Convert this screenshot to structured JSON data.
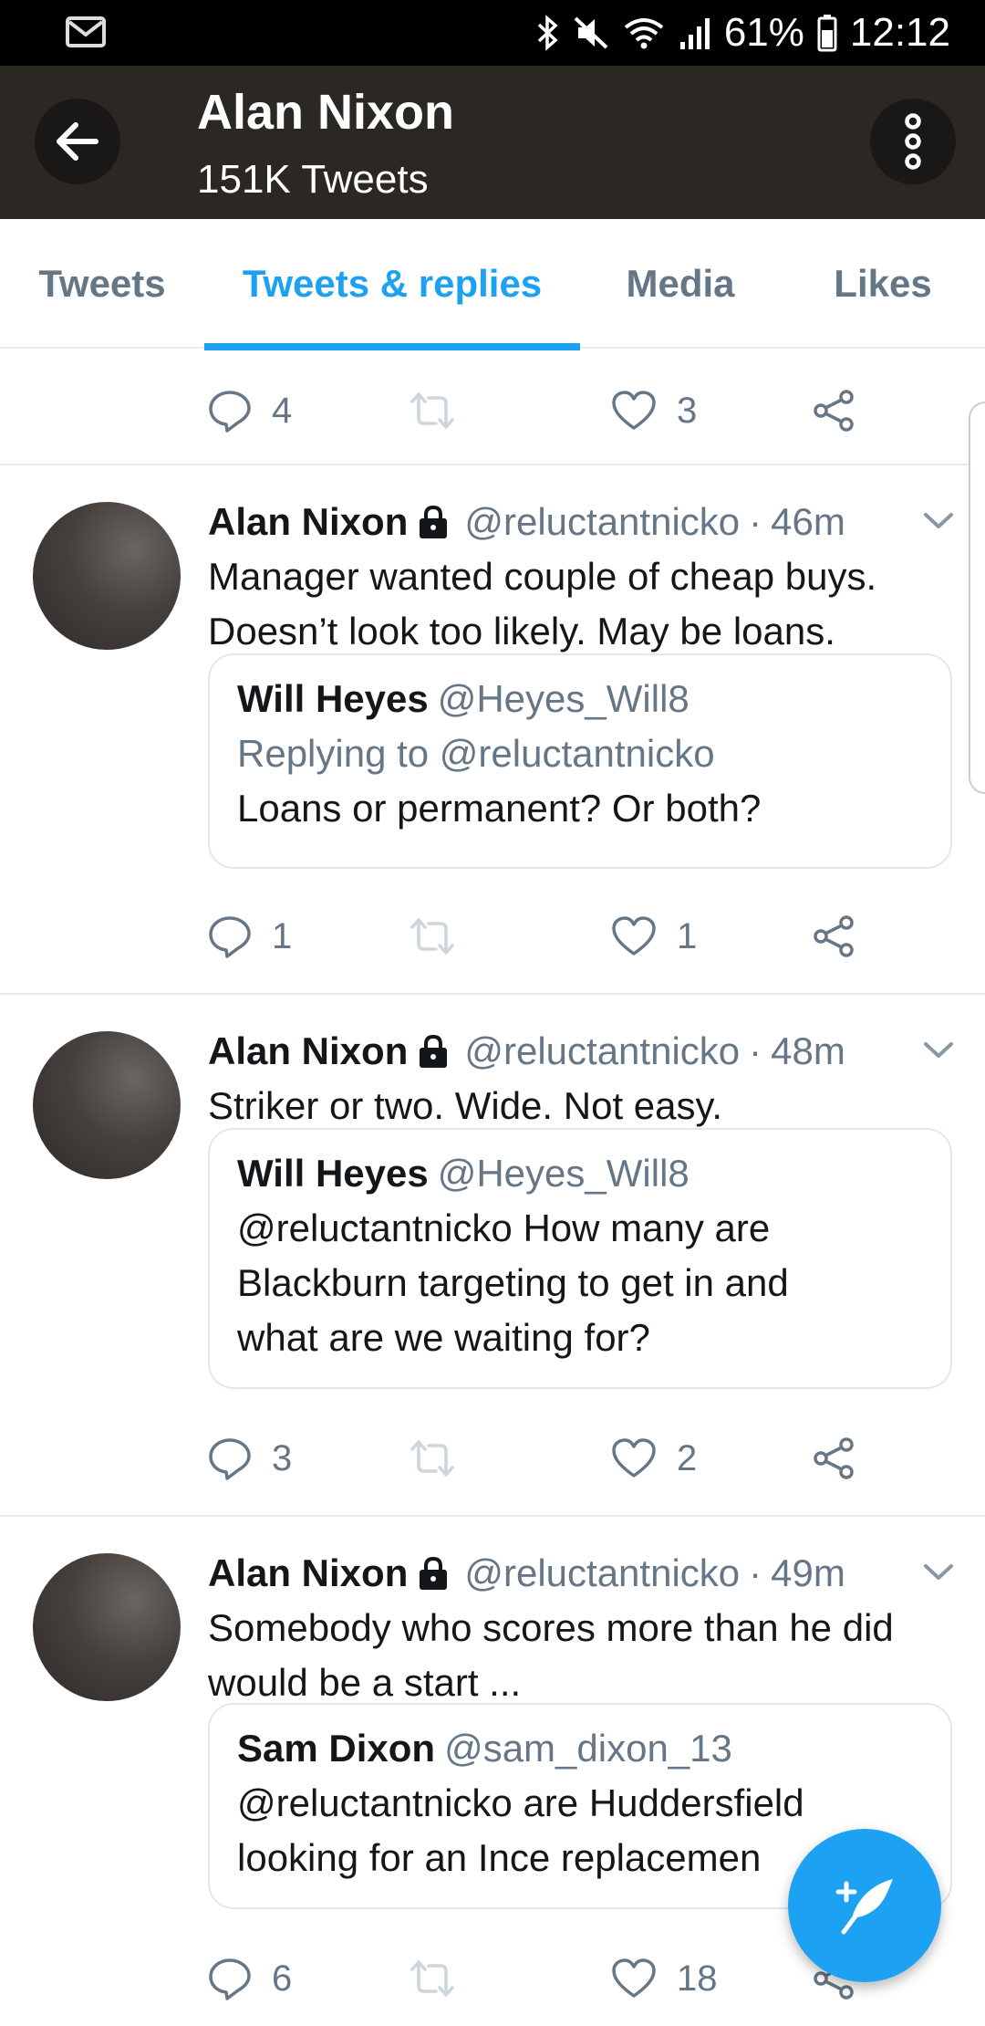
{
  "status_bar": {
    "battery_percent": "61%",
    "time": "12:12",
    "icons": [
      "mail-icon",
      "bluetooth-icon",
      "mute-icon",
      "wifi-icon",
      "signal-icon",
      "battery-icon"
    ]
  },
  "header": {
    "title": "Alan Nixon",
    "subtitle": "151K Tweets"
  },
  "tabs": [
    {
      "label": "Tweets",
      "active": false
    },
    {
      "label": "Tweets & replies",
      "active": true
    },
    {
      "label": "Media",
      "active": false
    },
    {
      "label": "Likes",
      "active": false
    }
  ],
  "top_tweet_actions": {
    "replies": "4",
    "likes": "3"
  },
  "tweets": [
    {
      "name": "Alan Nixon",
      "handle": "@reluctantnicko",
      "separator": "·",
      "time": "46m",
      "text_lines": [
        "Manager wanted couple of cheap buys.",
        "Doesn’t look too likely. May be loans."
      ],
      "quote": {
        "name": "Will Heyes",
        "handle": "@Heyes_Will8",
        "replying_to": "Replying to @reluctantnicko",
        "text_lines": [
          "Loans or permanent? Or both?"
        ]
      },
      "replies": "1",
      "likes": "1"
    },
    {
      "name": "Alan Nixon",
      "handle": "@reluctantnicko",
      "separator": "·",
      "time": "48m",
      "text_lines": [
        "Striker or two. Wide. Not easy."
      ],
      "quote": {
        "name": "Will Heyes",
        "handle": "@Heyes_Will8",
        "text_lines": [
          "@reluctantnicko How many are",
          "Blackburn targeting to get in and",
          "what are we waiting for?"
        ]
      },
      "replies": "3",
      "likes": "2"
    },
    {
      "name": "Alan Nixon",
      "handle": "@reluctantnicko",
      "separator": "·",
      "time": "49m",
      "text_lines": [
        "Somebody who scores more than he did",
        "would be a start ..."
      ],
      "quote": {
        "name": "Sam Dixon",
        "handle": "@sam_dixon_13",
        "text_lines": [
          "@reluctantnicko are Huddersfield",
          "looking for an Ince replacemen"
        ]
      },
      "replies": "6",
      "likes": "18"
    }
  ],
  "colors": {
    "accent": "#1da1f2",
    "header_bg": "#2b2824",
    "secondary_text": "#657786",
    "divider": "#e6ecf0"
  }
}
